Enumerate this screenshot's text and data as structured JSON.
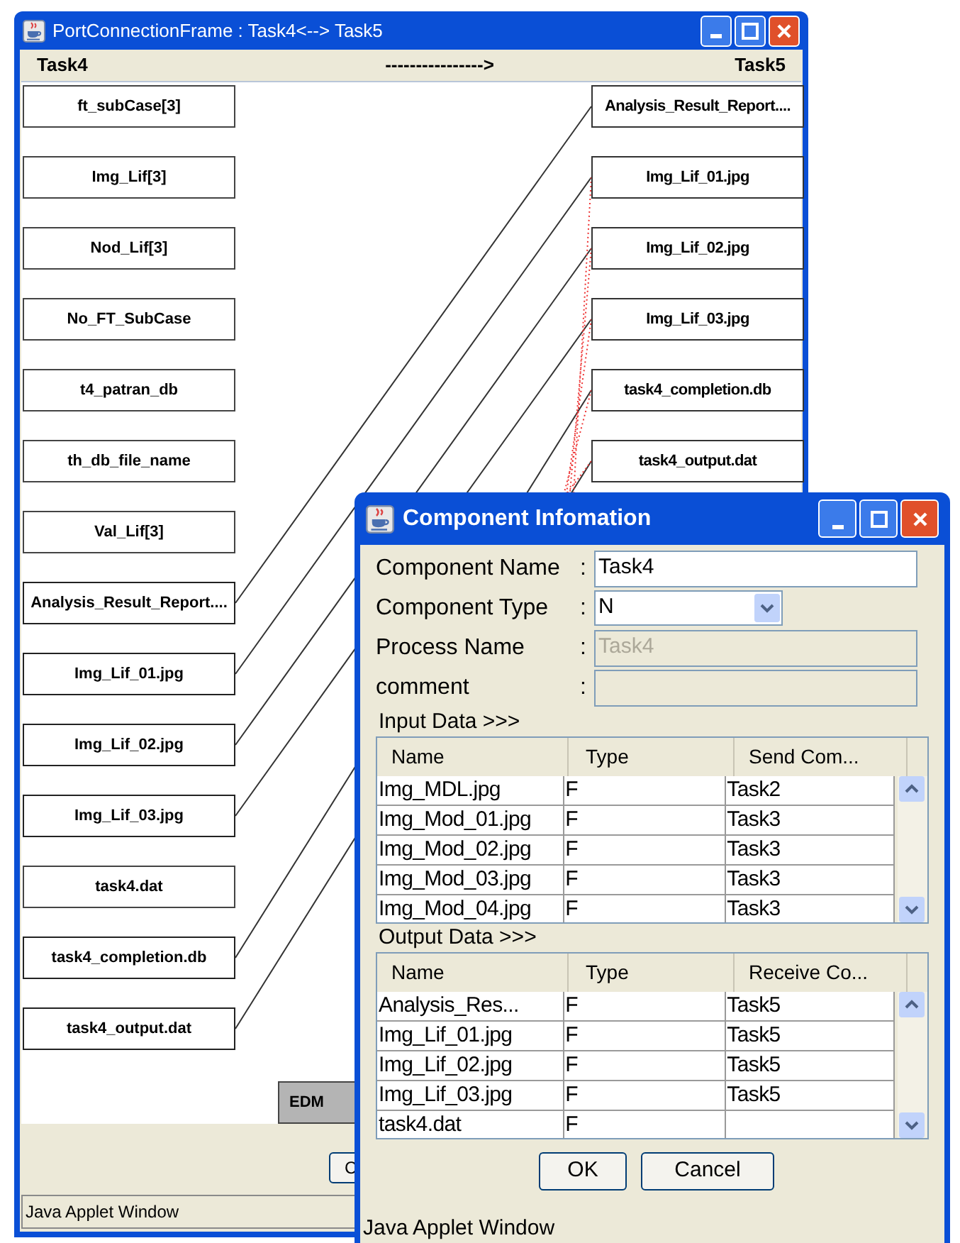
{
  "connection_window": {
    "title": "PortConnectionFrame : Task4<--> Task5",
    "source_label": "Task4",
    "arrow": "---------------->",
    "target_label": "Task5",
    "source_ports": [
      {
        "name": "ft_subCase[3]",
        "connected": false
      },
      {
        "name": "Img_Lif[3]",
        "connected": false
      },
      {
        "name": "Nod_Lif[3]",
        "connected": false
      },
      {
        "name": "No_FT_SubCase",
        "connected": false
      },
      {
        "name": "t4_patran_db",
        "connected": false
      },
      {
        "name": "th_db_file_name",
        "connected": false
      },
      {
        "name": "Val_Lif[3]",
        "connected": false
      },
      {
        "name": "Analysis_Result_Report....",
        "connected": true
      },
      {
        "name": "Img_Lif_01.jpg",
        "connected": true
      },
      {
        "name": "Img_Lif_02.jpg",
        "connected": true
      },
      {
        "name": "Img_Lif_03.jpg",
        "connected": true
      },
      {
        "name": "task4.dat",
        "connected": false
      },
      {
        "name": "task4_completion.db",
        "connected": true
      },
      {
        "name": "task4_output.dat",
        "connected": true
      }
    ],
    "target_ports": [
      {
        "name": "Analysis_Result_Report...."
      },
      {
        "name": "Img_Lif_01.jpg"
      },
      {
        "name": "Img_Lif_02.jpg"
      },
      {
        "name": "Img_Lif_03.jpg"
      },
      {
        "name": "task4_completion.db"
      },
      {
        "name": "task4_output.dat"
      }
    ],
    "edm_button": "EDM",
    "bottom_button": "C",
    "status": "Java Applet Window"
  },
  "dialog": {
    "title": "Component Infomation",
    "fields": [
      {
        "kind": "text",
        "label": "Component Name",
        "colon": ":",
        "value": "Task4",
        "disabled": false
      },
      {
        "kind": "dropdown",
        "label": "Component Type",
        "colon": ":",
        "value": "N",
        "disabled": false
      },
      {
        "kind": "text",
        "label": "Process Name",
        "colon": ":",
        "value": "Task4",
        "disabled": true
      },
      {
        "kind": "text",
        "label": "comment",
        "colon": ":",
        "disabled": true
      }
    ],
    "input_data": {
      "label": "Input Data >>>",
      "columns": [
        "Name",
        "Type",
        "Send Com..."
      ],
      "rows": [
        [
          "Img_MDL.jpg",
          "F",
          "Task2"
        ],
        [
          "Img_Mod_01.jpg",
          "F",
          "Task3"
        ],
        [
          "Img_Mod_02.jpg",
          "F",
          "Task3"
        ],
        [
          "Img_Mod_03.jpg",
          "F",
          "Task3"
        ],
        [
          "Img_Mod_04.jpg",
          "F",
          "Task3"
        ]
      ]
    },
    "output_data": {
      "label": "Output Data >>>",
      "columns": [
        "Name",
        "Type",
        "Receive Co..."
      ],
      "rows": [
        [
          "Analysis_Res...",
          "F",
          "Task5"
        ],
        [
          "Img_Lif_01.jpg",
          "F",
          "Task5"
        ],
        [
          "Img_Lif_02.jpg",
          "F",
          "Task5"
        ],
        [
          "Img_Lif_03.jpg",
          "F",
          "Task5"
        ],
        [
          "task4.dat",
          "F",
          ""
        ]
      ]
    },
    "buttons": [
      "OK",
      "Cancel"
    ],
    "status": "Java Applet Window"
  }
}
